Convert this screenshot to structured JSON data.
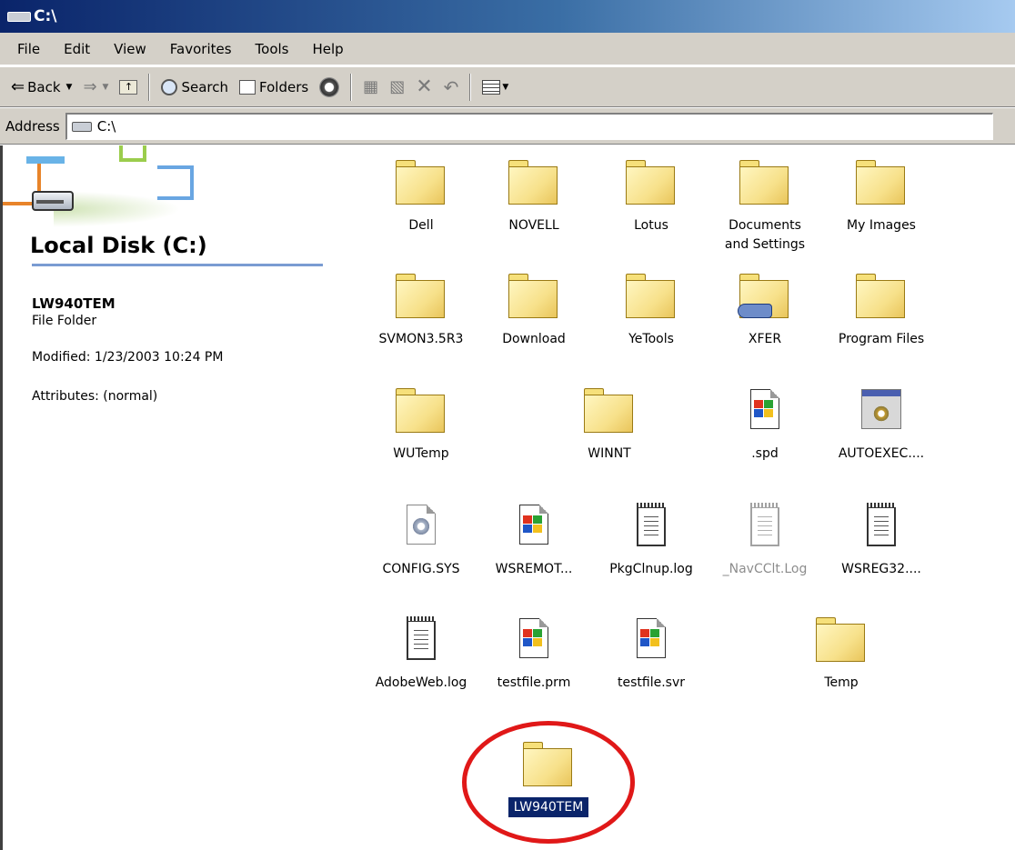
{
  "window": {
    "title": "C:\\"
  },
  "menu": [
    "File",
    "Edit",
    "View",
    "Favorites",
    "Tools",
    "Help"
  ],
  "toolbar": {
    "back": "Back",
    "search": "Search",
    "folders": "Folders"
  },
  "address": {
    "label": "Address",
    "value": "C:\\"
  },
  "left_pane": {
    "heading": "Local Disk (C:)",
    "selected_name": "LW940TEM",
    "selected_type": "File Folder",
    "modified": "Modified: 1/23/2003 10:24 PM",
    "attributes": "Attributes: (normal)"
  },
  "items": [
    {
      "label": "Dell",
      "icon": "folder-icon"
    },
    {
      "label": "NOVELL",
      "icon": "folder-icon"
    },
    {
      "label": "Lotus",
      "icon": "folder-icon"
    },
    {
      "label": "Documents\nand Settings",
      "icon": "folder-icon"
    },
    {
      "label": "My Images",
      "icon": "folder-icon"
    },
    {
      "label": "SVMON3.5R3",
      "icon": "folder-icon"
    },
    {
      "label": "Download",
      "icon": "folder-icon"
    },
    {
      "label": "YeTools",
      "icon": "folder-icon"
    },
    {
      "label": "XFER",
      "icon": "shared-folder-icon"
    },
    {
      "label": "Program Files",
      "icon": "folder-icon"
    },
    {
      "label": "WUTemp",
      "icon": "folder-icon"
    },
    {
      "label": "WINNT",
      "icon": "folder-icon"
    },
    {
      "label": ".spd",
      "icon": "windows-file-icon"
    },
    {
      "label": "AUTOEXEC....",
      "icon": "application-icon"
    },
    {
      "label": "CONFIG.SYS",
      "icon": "system-file-icon"
    },
    {
      "label": "WSREMOT...",
      "icon": "windows-file-icon"
    },
    {
      "label": "PkgClnup.log",
      "icon": "notepad-icon"
    },
    {
      "label": "_NavCClt.Log",
      "icon": "notepad-icon"
    },
    {
      "label": "WSREG32....",
      "icon": "notepad-icon"
    },
    {
      "label": "AdobeWeb.log",
      "icon": "notepad-icon"
    },
    {
      "label": "testfile.prm",
      "icon": "windows-file-icon"
    },
    {
      "label": "testfile.svr",
      "icon": "windows-file-icon"
    },
    {
      "label": "Temp",
      "icon": "folder-icon"
    },
    {
      "label": "LW940TEM",
      "icon": "folder-icon",
      "selected": true
    }
  ]
}
